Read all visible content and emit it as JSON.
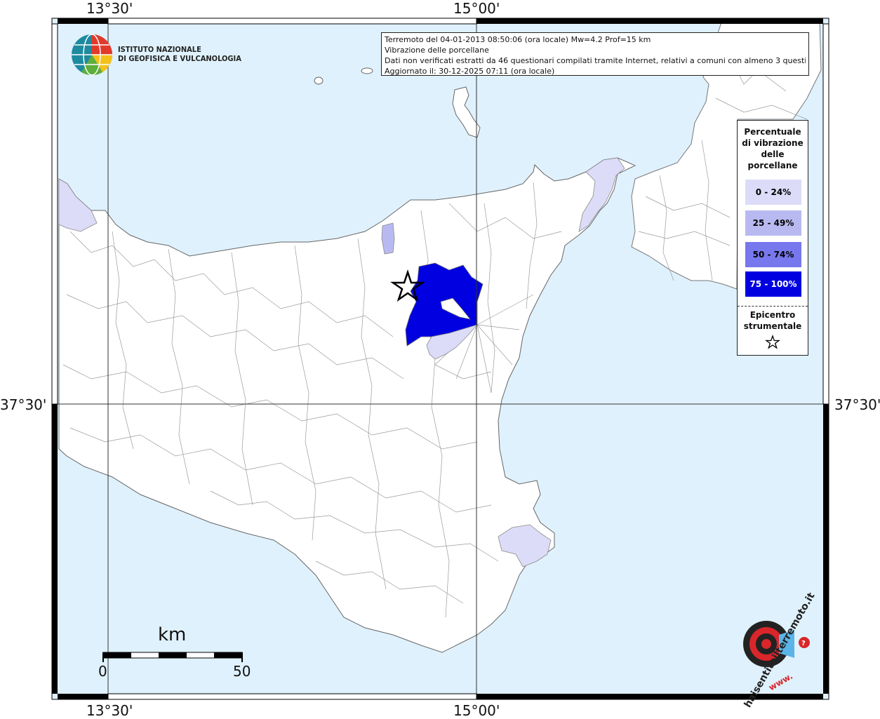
{
  "map": {
    "colors": {
      "sea": "#dff1fc",
      "land": "#ffffff",
      "border": "#8a8a8a",
      "cls0": "#dcdcf8",
      "cls1": "#b9b9f2",
      "cls2": "#7777ee",
      "cls3": "#0000e0"
    },
    "ticks": {
      "top_left": "13°30'",
      "top_right": "15°00'",
      "bottom_left": "13°30'",
      "bottom_right": "15°00'",
      "left_lat": "37°30'",
      "right_lat": "37°30'"
    }
  },
  "ingv": {
    "line1": "ISTITUTO NAZIONALE",
    "line2": "DI GEOFISICA E VULCANOLOGIA"
  },
  "info": {
    "line1": "Terremoto del 04-01-2013 08:50:06 (ora locale) Mw=4.2 Prof=15 km",
    "line2": "Vibrazione delle porcellane",
    "line3": "Dati non verificati estratti da 46 questionari compilati tramite Internet, relativi a comuni con almeno 3 questionari.",
    "line4": "Aggiornato il: 30-12-2025 07:11 (ora locale)"
  },
  "legend": {
    "title_lines": [
      "Percentuale",
      "di vibrazione",
      "delle",
      "porcellane"
    ],
    "classes": [
      {
        "label": "0 - 24%",
        "color": "#dcdcf8",
        "text": "#000"
      },
      {
        "label": "25 - 49%",
        "color": "#b9b9f2",
        "text": "#000"
      },
      {
        "label": "50 - 74%",
        "color": "#7777ee",
        "text": "#000"
      },
      {
        "label": "75 - 100%",
        "color": "#0000e0",
        "text": "#fff"
      }
    ],
    "epicenter_lines": [
      "Epicentro",
      "strumentale"
    ],
    "star_icon": "star-icon"
  },
  "scale": {
    "unit": "km",
    "min": "0",
    "max": "50"
  },
  "watermark": {
    "text": "haisentitoilterremoto.it",
    "www": "www."
  }
}
